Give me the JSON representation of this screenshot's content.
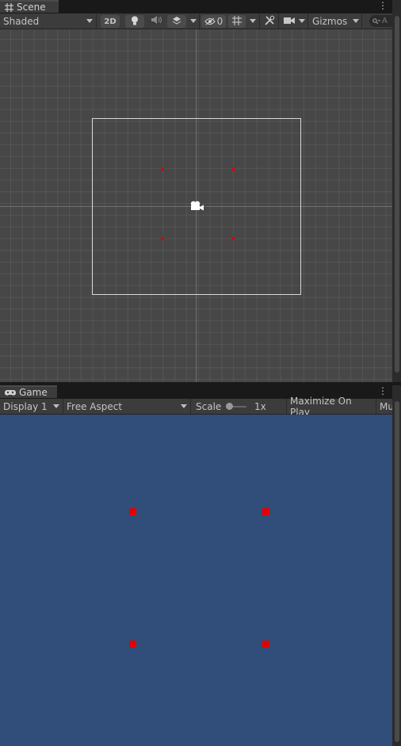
{
  "scene": {
    "tab_label": "Scene",
    "shading_mode": "Shaded",
    "toggle_2d": "2D",
    "hidden_count": "0",
    "gizmos_label": "Gizmos",
    "search_placeholder": "A"
  },
  "game": {
    "tab_label": "Game",
    "display": "Display 1",
    "aspect": "Free Aspect",
    "scale_label": "Scale",
    "scale_value": "1x",
    "maximize_on_play": "Maximize On Play",
    "mute_truncated": "Mu"
  },
  "colors": {
    "scene_background": "#474747",
    "game_background": "#314d7a",
    "marker_red": "#e00000",
    "frame_white": "#d8d8d8"
  },
  "icons": [
    "grid-icon",
    "lightbulb-icon",
    "audio-icon",
    "effects-layers-icon",
    "hidden-eye-icon",
    "grid-snap-icon",
    "tools-icon",
    "camera-icon",
    "search-icon",
    "game-controller-icon",
    "kebab-menu-icon"
  ]
}
